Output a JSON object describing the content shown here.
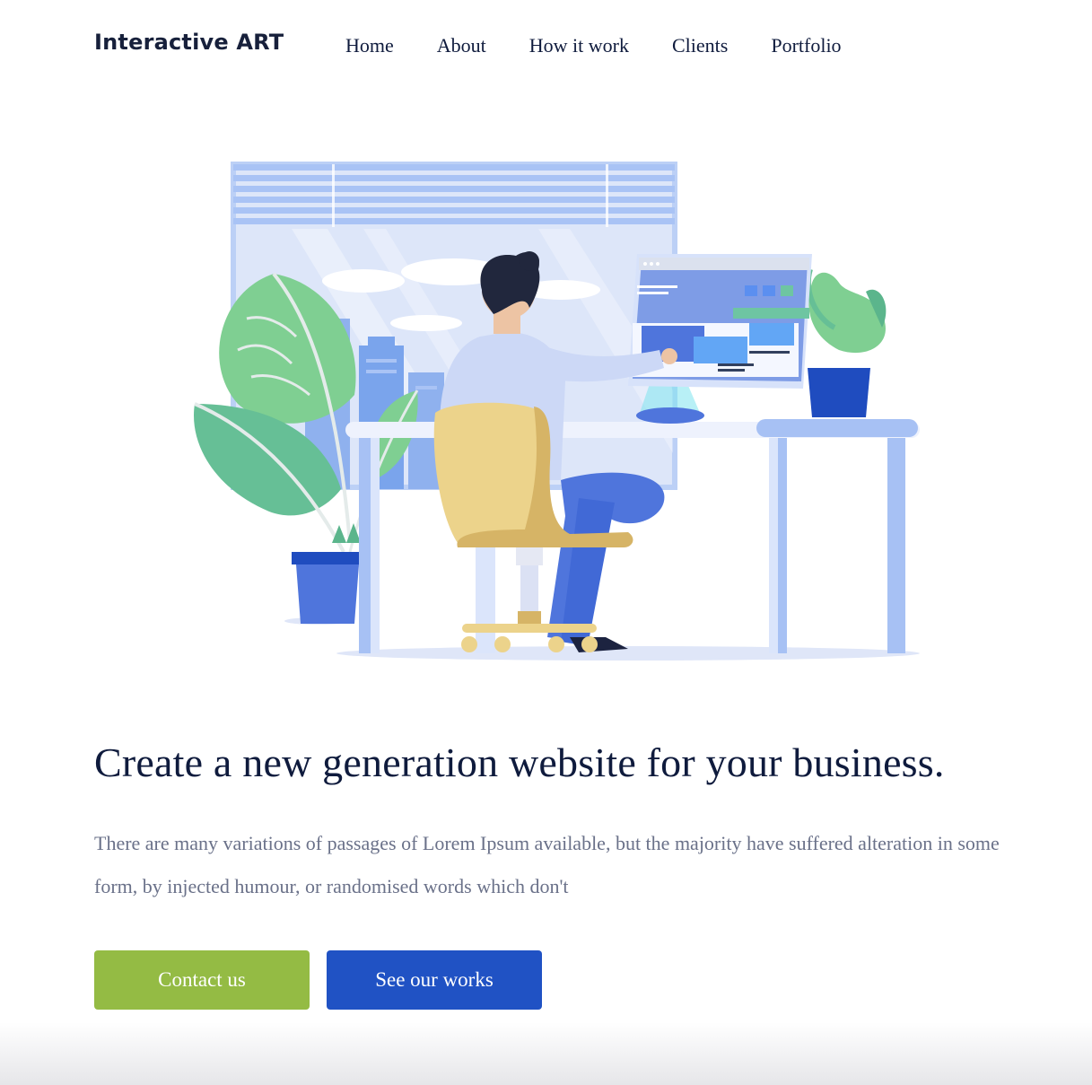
{
  "header": {
    "logo": "Interactive ART",
    "nav": [
      {
        "label": "Home"
      },
      {
        "label": "About"
      },
      {
        "label": "How it work"
      },
      {
        "label": "Clients"
      },
      {
        "label": "Portfolio"
      }
    ]
  },
  "hero": {
    "illustration": "person-at-desk-illustration",
    "title": "Create a new generation website for your business.",
    "description": "There are many variations of passages of Lorem Ipsum available, but the majority have suffered alteration in some form, by injected humour, or randomised words which don't",
    "buttons": {
      "contact": "Contact us",
      "works": "See our works"
    }
  },
  "colors": {
    "text_dark": "#0f1b3d",
    "text_muted": "#6a7189",
    "contact_button": "#94bb44",
    "works_button": "#2052c4",
    "illustration_blue": "#a7c1f4",
    "plant_green": "#7dcf93",
    "chair_yellow": "#ebd38b"
  }
}
